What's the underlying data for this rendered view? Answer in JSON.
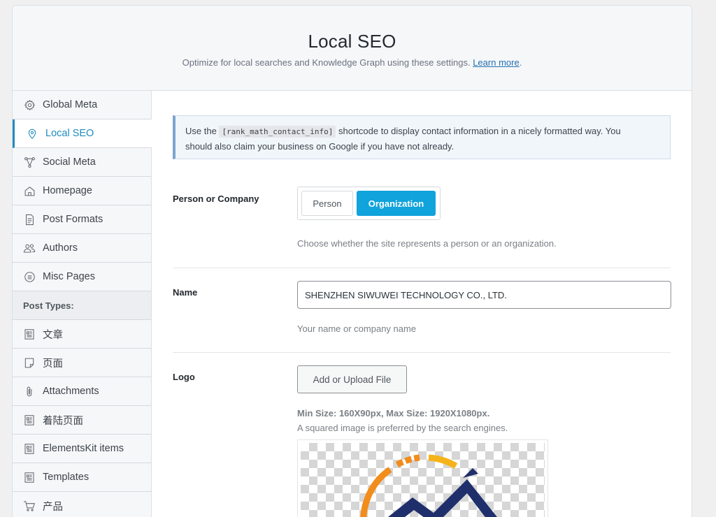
{
  "header": {
    "title": "Local SEO",
    "subtitle": "Optimize for local searches and Knowledge Graph using these settings.",
    "learn_more": "Learn more",
    "period": "."
  },
  "sidebar": {
    "items": [
      {
        "label": "Global Meta",
        "icon": "gear-icon"
      },
      {
        "label": "Local SEO",
        "icon": "location-pin-icon",
        "active": true
      },
      {
        "label": "Social Meta",
        "icon": "share-nodes-icon"
      },
      {
        "label": "Homepage",
        "icon": "home-icon"
      },
      {
        "label": "Post Formats",
        "icon": "document-icon"
      },
      {
        "label": "Authors",
        "icon": "users-icon"
      },
      {
        "label": "Misc Pages",
        "icon": "list-circle-icon"
      }
    ],
    "section_label": "Post Types:",
    "post_types": [
      {
        "label": "文章",
        "icon": "post-icon"
      },
      {
        "label": "页面",
        "icon": "page-icon"
      },
      {
        "label": "Attachments",
        "icon": "paperclip-icon"
      },
      {
        "label": "着陆页面",
        "icon": "post-icon"
      },
      {
        "label": "ElementsKit items",
        "icon": "post-icon"
      },
      {
        "label": "Templates",
        "icon": "post-icon"
      },
      {
        "label": "产品",
        "icon": "cart-icon"
      }
    ]
  },
  "notice": {
    "before": "Use the",
    "code": "[rank_math_contact_info]",
    "after_line1": "shortcode to display contact information in a nicely formatted way. You",
    "line2": "should also claim your business on Google if you have not already."
  },
  "person_company": {
    "label": "Person or Company",
    "options": [
      "Person",
      "Organization"
    ],
    "selected": "Organization",
    "description": "Choose whether the site represents a person or an organization."
  },
  "name_field": {
    "label": "Name",
    "value": "SHENZHEN SIWUWEI TECHNOLOGY CO., LTD.",
    "description": "Your name or company name"
  },
  "logo_field": {
    "label": "Logo",
    "button": "Add or Upload File",
    "size_note": "Min Size: 160X90px, Max Size: 1920X1080px.",
    "description": "A squared image is preferred by the search engines."
  },
  "colors": {
    "accent": "#1e8cbe",
    "toggle_selected": "#10a3dc",
    "logo_orange": "#f28c1b",
    "logo_navy": "#1f2f6b",
    "logo_yellow": "#f5b31a"
  }
}
